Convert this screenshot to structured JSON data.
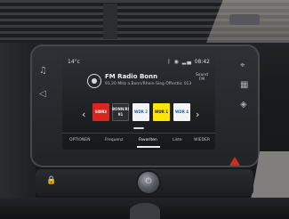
{
  "status_bar": {
    "temperature": "14°c",
    "time": "08:42",
    "icons": [
      "bluetooth-icon",
      "location-icon",
      "signal-icon"
    ]
  },
  "now_playing": {
    "station": "FM Radio Bonn",
    "details": "91,20 MHz  a.Bonn/Rhein-Sieg Öffentlic 013"
  },
  "sound_button": "Sound\nFM",
  "presets": [
    {
      "label": "SWR3",
      "bg": "#d9261c"
    },
    {
      "label": "BONN/RS 91"
    },
    {
      "label": "WDR 2",
      "bg": "#f4f4f4"
    },
    {
      "label": "WDR 1",
      "bg": "#ffe600"
    },
    {
      "label": "WDR 4",
      "bg": "#f4f4f4"
    }
  ],
  "tabs": [
    "OPTIONEN",
    "Frequenz",
    "Favoriten",
    "Liste",
    "WIEDER"
  ],
  "active_tab": "Favoriten",
  "hazard_color": "#d52a20"
}
